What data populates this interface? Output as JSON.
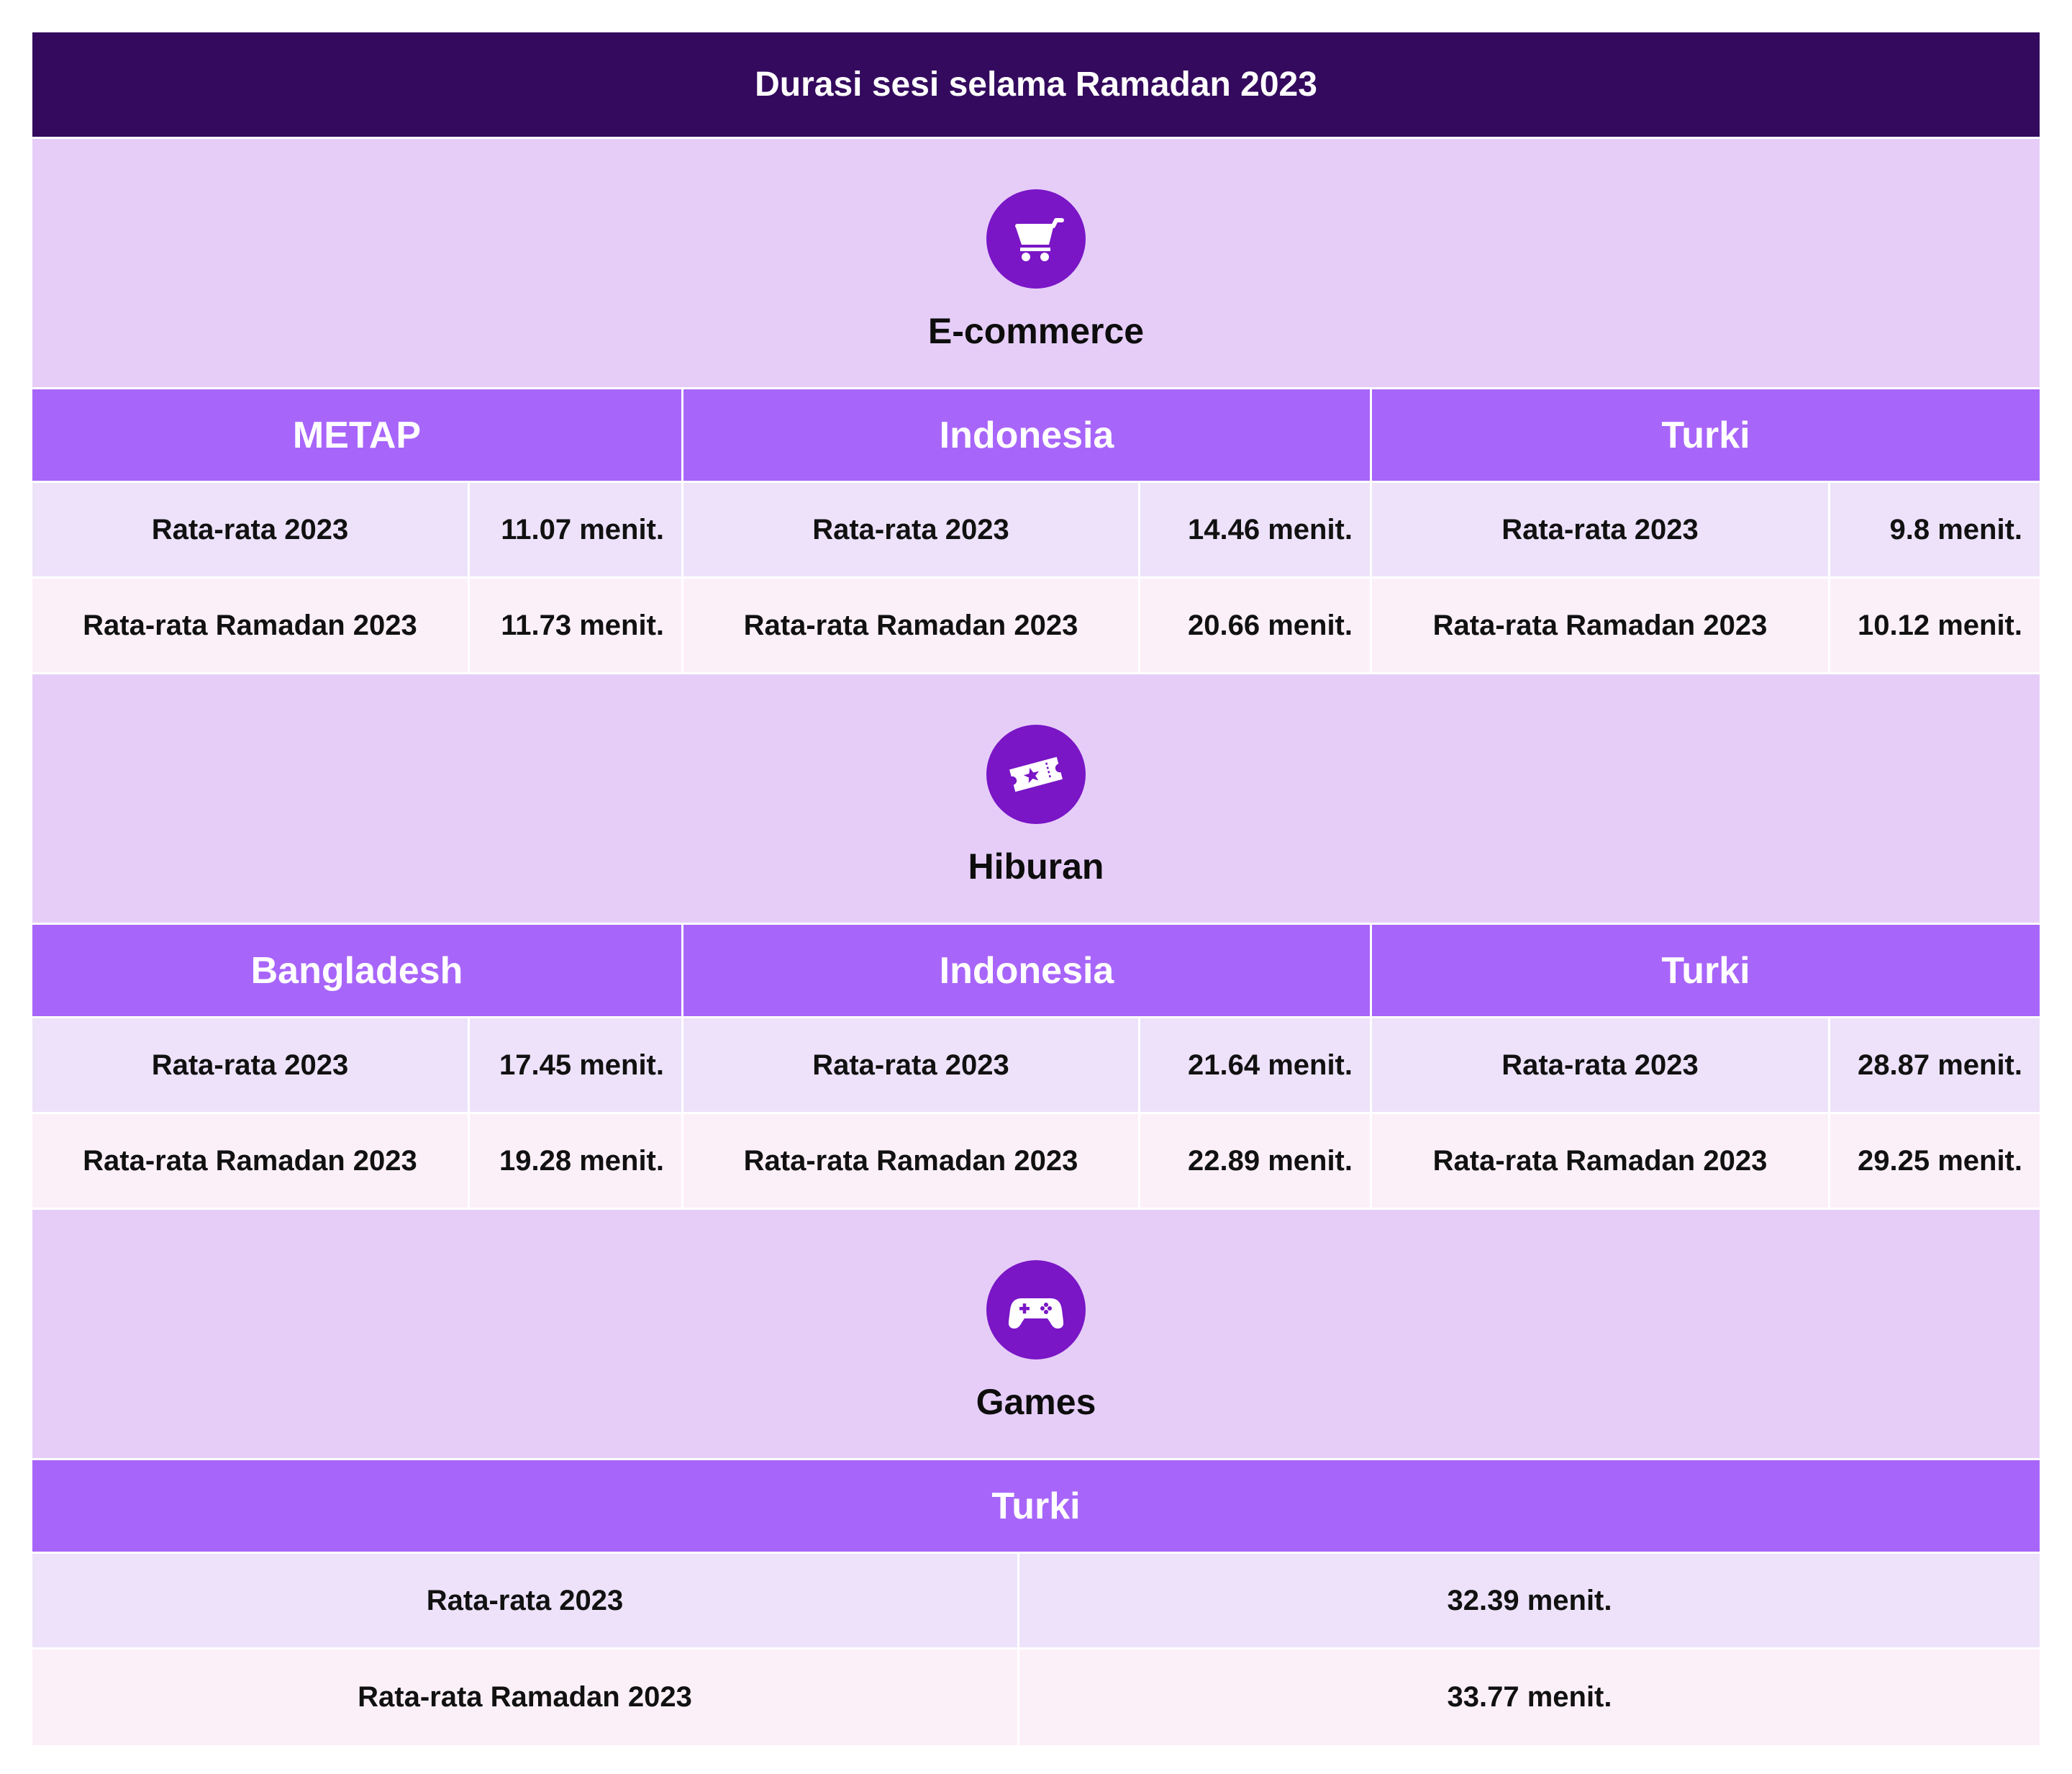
{
  "title": "Durasi sesi selama Ramadan 2023",
  "sections": [
    {
      "title": "E-commerce",
      "icon": "shopping-cart-icon",
      "regions": [
        {
          "name": "METAP",
          "rows": [
            {
              "label": "Rata-rata 2023",
              "value": "11.07 menit."
            },
            {
              "label": "Rata-rata Ramadan 2023",
              "value": "11.73 menit."
            }
          ]
        },
        {
          "name": "Indonesia",
          "rows": [
            {
              "label": "Rata-rata 2023",
              "value": "14.46 menit."
            },
            {
              "label": "Rata-rata Ramadan 2023",
              "value": "20.66 menit."
            }
          ]
        },
        {
          "name": "Turki",
          "rows": [
            {
              "label": "Rata-rata 2023",
              "value": "9.8 menit."
            },
            {
              "label": "Rata-rata Ramadan 2023",
              "value": "10.12 menit."
            }
          ]
        }
      ]
    },
    {
      "title": "Hiburan",
      "icon": "ticket-star-icon",
      "regions": [
        {
          "name": "Bangladesh",
          "rows": [
            {
              "label": "Rata-rata 2023",
              "value": "17.45 menit."
            },
            {
              "label": "Rata-rata Ramadan 2023",
              "value": "19.28 menit."
            }
          ]
        },
        {
          "name": "Indonesia",
          "rows": [
            {
              "label": "Rata-rata 2023",
              "value": "21.64 menit."
            },
            {
              "label": "Rata-rata Ramadan 2023",
              "value": "22.89 menit."
            }
          ]
        },
        {
          "name": "Turki",
          "rows": [
            {
              "label": "Rata-rata 2023",
              "value": "28.87 menit."
            },
            {
              "label": "Rata-rata Ramadan 2023",
              "value": "29.25 menit."
            }
          ]
        }
      ]
    },
    {
      "title": "Games",
      "icon": "gamepad-icon",
      "regions": [
        {
          "name": "Turki",
          "rows": [
            {
              "label": "Rata-rata 2023",
              "value": "32.39 menit."
            },
            {
              "label": "Rata-rata Ramadan 2023",
              "value": "33.77 menit."
            }
          ]
        }
      ]
    }
  ],
  "colors": {
    "title_bar": "#340a5e",
    "category_band": "#e6cdf8",
    "icon_circle": "#7a16c6",
    "region_header": "#a865fa",
    "row_1": "#ede2fa",
    "row_2": "#fcf0f8"
  }
}
